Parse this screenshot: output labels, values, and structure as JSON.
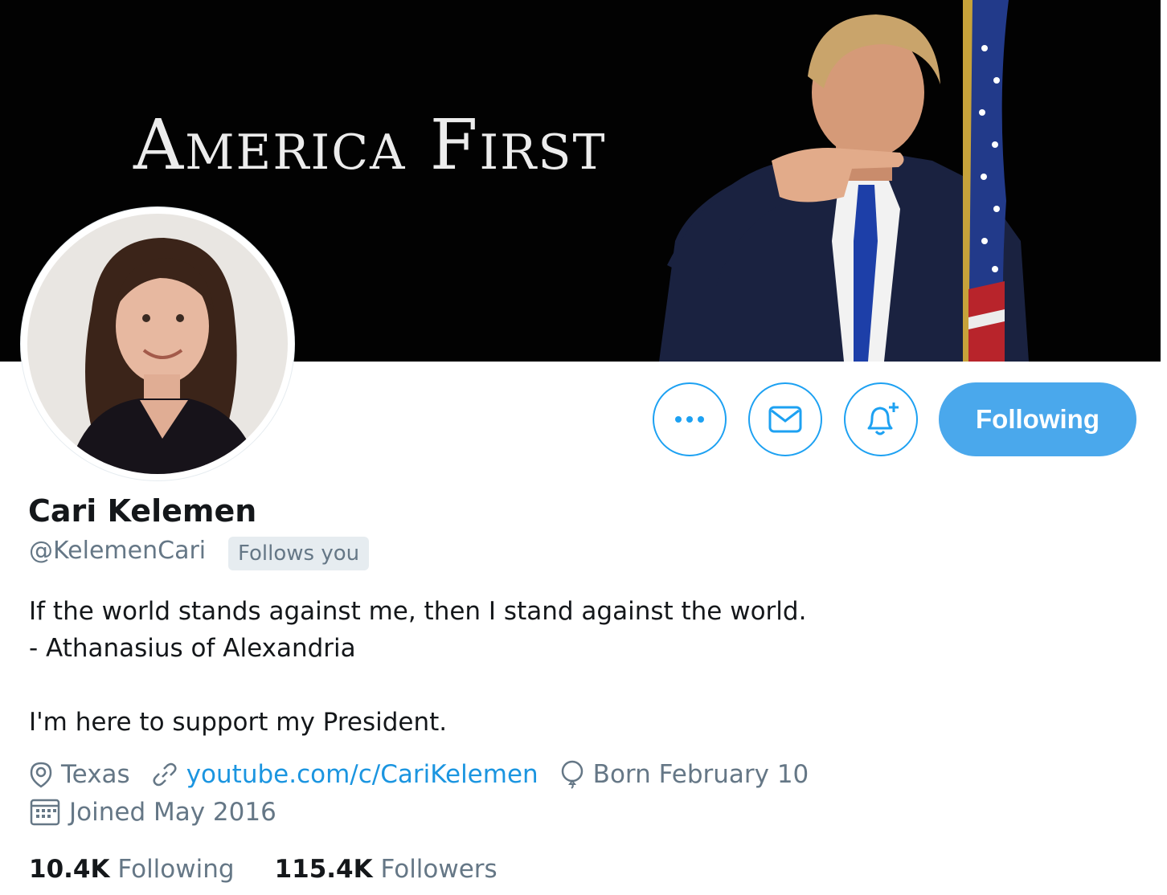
{
  "banner": {
    "title": "America First"
  },
  "profile": {
    "name": "Cari Kelemen",
    "handle": "@KelemenCari",
    "follows_you_badge": "Follows you",
    "bio": {
      "line1": "If the world stands against me, then I stand against the world.",
      "line2": "- Athanasius of Alexandria",
      "line3": "I'm here to support my President."
    },
    "location": "Texas",
    "website": "youtube.com/c/CariKelemen",
    "birthday": "Born February 10",
    "joined": "Joined May 2016"
  },
  "actions": {
    "following_label": "Following"
  },
  "stats": {
    "following_count": "10.4K",
    "following_label": "Following",
    "followers_count": "115.4K",
    "followers_label": "Followers"
  },
  "colors": {
    "accent": "#1da1f2",
    "following_button": "#4aa8ec",
    "secondary_text": "#657786",
    "link": "#1b95e0",
    "banner_background": "#020202"
  },
  "icons": {
    "more": "more-icon",
    "message": "mail-icon",
    "notify": "bell-plus-icon",
    "location": "location-pin-icon",
    "website": "link-icon",
    "birthday": "balloon-icon",
    "joined": "calendar-icon"
  }
}
